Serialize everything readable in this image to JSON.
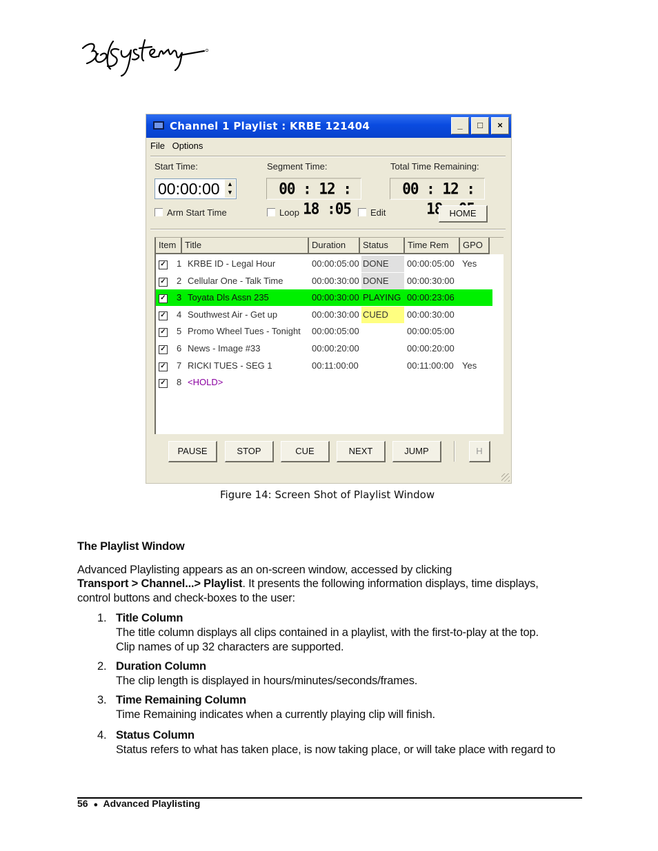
{
  "logo": {
    "text": "360 Systems"
  },
  "window": {
    "title": "Channel 1 Playlist : KRBE 121404",
    "controls": {
      "minimize": "_",
      "maximize": "□",
      "close": "×"
    },
    "menu": [
      "File",
      "Options"
    ],
    "start_time": {
      "label": "Start Time:",
      "value": "00:00:00"
    },
    "segment_time": {
      "label": "Segment Time:",
      "value": "00 : 12 : 18 :05"
    },
    "total_remaining": {
      "label": "Total Time Remaining:",
      "value": "00 : 12 : 18 :05"
    },
    "checkboxes": [
      {
        "label": "Arm Start Time",
        "checked": false
      },
      {
        "label": "Loop",
        "checked": false
      },
      {
        "label": "Edit",
        "checked": false
      }
    ],
    "home_button": "HOME",
    "columns": [
      "Item",
      "Title",
      "Duration",
      "Status",
      "Time Rem",
      "GPO"
    ],
    "rows": [
      {
        "num": "1",
        "checked": true,
        "title": "KRBE ID - Legal Hour",
        "duration": "00:00:05:00",
        "status": "DONE",
        "time_rem": "00:00:05:00",
        "gpo": "Yes"
      },
      {
        "num": "2",
        "checked": true,
        "title": "Cellular One - Talk Time",
        "duration": "00:00:30:00",
        "status": "DONE",
        "time_rem": "00:00:30:00",
        "gpo": ""
      },
      {
        "num": "3",
        "checked": true,
        "title": "Toyata Dls Assn 235",
        "duration": "00:00:30:00",
        "status": "PLAYING",
        "time_rem": "00:00:23:06",
        "gpo": ""
      },
      {
        "num": "4",
        "checked": true,
        "title": "Southwest Air - Get up",
        "duration": "00:00:30:00",
        "status": "CUED",
        "time_rem": "00:00:30:00",
        "gpo": ""
      },
      {
        "num": "5",
        "checked": true,
        "title": "Promo Wheel Tues - Tonight",
        "duration": "00:00:05:00",
        "status": "",
        "time_rem": "00:00:05:00",
        "gpo": ""
      },
      {
        "num": "6",
        "checked": true,
        "title": "News - Image #33",
        "duration": "00:00:20:00",
        "status": "",
        "time_rem": "00:00:20:00",
        "gpo": ""
      },
      {
        "num": "7",
        "checked": true,
        "title": "RICKI TUES - SEG 1",
        "duration": "00:11:00:00",
        "status": "",
        "time_rem": "00:11:00:00",
        "gpo": "Yes"
      },
      {
        "num": "8",
        "checked": true,
        "title": "<HOLD>",
        "duration": "",
        "status": "",
        "time_rem": "",
        "gpo": ""
      }
    ],
    "buttons": [
      "PAUSE",
      "STOP",
      "CUE",
      "NEXT",
      "JUMP"
    ],
    "h_button": "H",
    "colors": {
      "playing": "#00f000",
      "cued": "#ffff80",
      "done": "#e0e0e0",
      "hold": "#8a00a0",
      "titlebar": "#0a4be0"
    }
  },
  "caption": "Figure 14:  Screen Shot of Playlist Window",
  "doc": {
    "heading": "The Playlist Window",
    "intro_line1": "Advanced Playlisting appears as an on-screen window, accessed by clicking",
    "intro_bold": "Transport > Channel...>  Playlist",
    "intro_line2_rest": ".  It presents the following information displays, time displays,",
    "intro_line3": "control buttons and check-boxes to the user:",
    "items": [
      {
        "n": "1.",
        "title": "Title Column",
        "text1": "The title column displays all clips contained in a playlist, with the first-to-play at the top.",
        "text2": "Clip names of up 32 characters are supported."
      },
      {
        "n": "2.",
        "title": "Duration Column",
        "text1": "The clip length is displayed in hours/minutes/seconds/frames."
      },
      {
        "n": "3.",
        "title": "Time Remaining Column",
        "text1": "Time Remaining indicates when a currently playing clip will finish."
      },
      {
        "n": "4.",
        "title": "Status Column",
        "text1": "Status refers to what has taken place, is now taking place, or will take place with regard to"
      }
    ]
  },
  "footer": {
    "page": "56",
    "bullet": "●",
    "section": "Advanced Playlisting"
  }
}
